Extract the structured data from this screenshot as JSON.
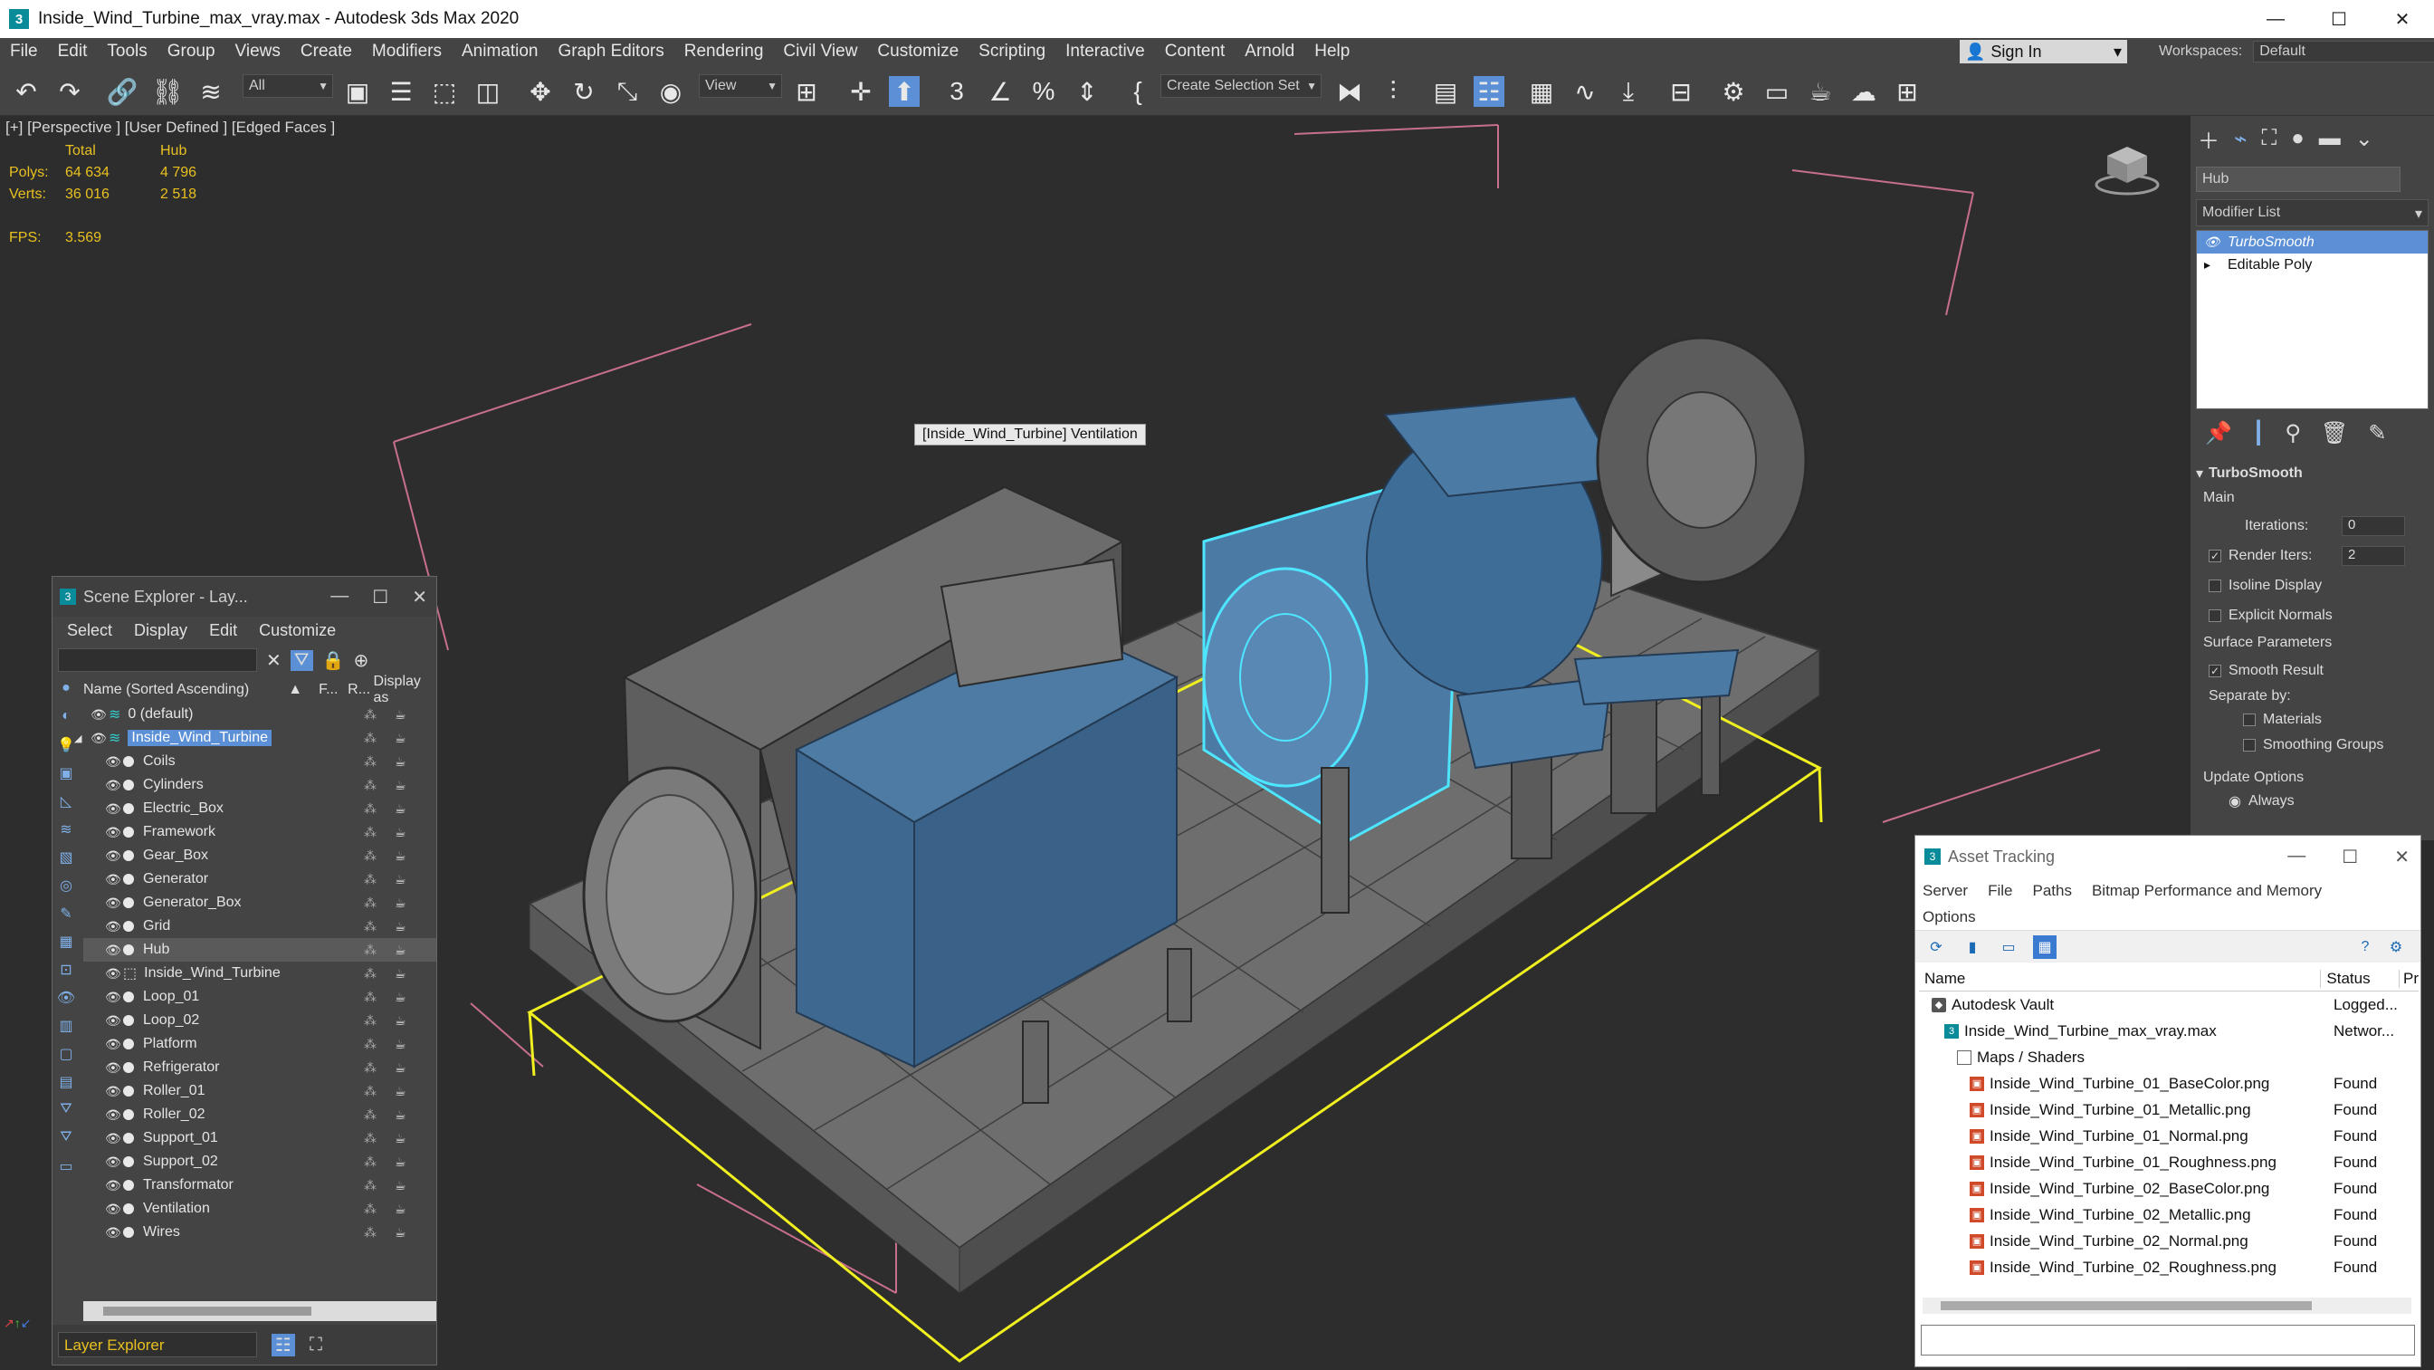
{
  "window": {
    "title": "Inside_Wind_Turbine_max_vray.max - Autodesk 3ds Max 2020",
    "app_icon_glyph": "3",
    "minimize_glyph": "—",
    "maximize_glyph": "☐",
    "close_glyph": "✕"
  },
  "menubar": {
    "items": [
      "File",
      "Edit",
      "Tools",
      "Group",
      "Views",
      "Create",
      "Modifiers",
      "Animation",
      "Graph Editors",
      "Rendering",
      "Civil View",
      "Customize",
      "Scripting",
      "Interactive",
      "Content",
      "Arnold",
      "Help"
    ],
    "signin_label": "Sign In",
    "workspaces_label": "Workspaces:",
    "workspaces_value": "Default"
  },
  "toolbar": {
    "filter_value": "All",
    "refcoord_value": "View",
    "selection_set_placeholder": "Create Selection Set"
  },
  "viewport": {
    "label": "[+] [Perspective ] [User Defined ] [Edged Faces ]",
    "stats": {
      "header_total": "Total",
      "header_selected": "Hub",
      "polys_label": "Polys:",
      "polys_total": "64 634",
      "polys_selected": "4 796",
      "verts_label": "Verts:",
      "verts_total": "36 016",
      "verts_selected": "2 518",
      "fps_label": "FPS:",
      "fps_value": "3.569"
    },
    "tooltip": "[Inside_Wind_Turbine] Ventilation"
  },
  "command_panel": {
    "object_name": "Hub",
    "modifier_list_label": "Modifier List",
    "stack": [
      {
        "label": "TurboSmooth",
        "selected": true
      },
      {
        "label": "Editable Poly",
        "selected": false
      }
    ],
    "rollout_title": "TurboSmooth",
    "main_label": "Main",
    "iterations_label": "Iterations:",
    "iterations_value": "0",
    "render_iters_label": "Render Iters:",
    "render_iters_value": "2",
    "isoline_label": "Isoline Display",
    "explicit_normals_label": "Explicit Normals",
    "surface_params_label": "Surface Parameters",
    "smooth_result_label": "Smooth Result",
    "separate_by_label": "Separate by:",
    "materials_label": "Materials",
    "smoothing_groups_label": "Smoothing Groups",
    "update_options_label": "Update Options",
    "always_label": "Always"
  },
  "scene_explorer": {
    "title": "Scene Explorer - Lay...",
    "menu": [
      "Select",
      "Display",
      "Edit",
      "Customize"
    ],
    "col_name": "Name (Sorted Ascending)",
    "col_f": "F...",
    "col_r": "R...",
    "col_display": "Display as",
    "rows": [
      {
        "label": "0 (default)",
        "level": 1,
        "kind": "layer",
        "selected": false
      },
      {
        "label": "Inside_Wind_Turbine",
        "level": 1,
        "kind": "layer",
        "selected": false,
        "highlight": true
      },
      {
        "label": "Coils",
        "level": 2,
        "kind": "object",
        "selected": false
      },
      {
        "label": "Cylinders",
        "level": 2,
        "kind": "object",
        "selected": false
      },
      {
        "label": "Electric_Box",
        "level": 2,
        "kind": "object",
        "selected": false
      },
      {
        "label": "Framework",
        "level": 2,
        "kind": "object",
        "selected": false
      },
      {
        "label": "Gear_Box",
        "level": 2,
        "kind": "object",
        "selected": false
      },
      {
        "label": "Generator",
        "level": 2,
        "kind": "object",
        "selected": false
      },
      {
        "label": "Generator_Box",
        "level": 2,
        "kind": "object",
        "selected": false
      },
      {
        "label": "Grid",
        "level": 2,
        "kind": "object",
        "selected": false
      },
      {
        "label": "Hub",
        "level": 2,
        "kind": "object",
        "selected": true
      },
      {
        "label": "Inside_Wind_Turbine",
        "level": 2,
        "kind": "group",
        "selected": false
      },
      {
        "label": "Loop_01",
        "level": 2,
        "kind": "object",
        "selected": false
      },
      {
        "label": "Loop_02",
        "level": 2,
        "kind": "object",
        "selected": false
      },
      {
        "label": "Platform",
        "level": 2,
        "kind": "object",
        "selected": false
      },
      {
        "label": "Refrigerator",
        "level": 2,
        "kind": "object",
        "selected": false
      },
      {
        "label": "Roller_01",
        "level": 2,
        "kind": "object",
        "selected": false
      },
      {
        "label": "Roller_02",
        "level": 2,
        "kind": "object",
        "selected": false
      },
      {
        "label": "Support_01",
        "level": 2,
        "kind": "object",
        "selected": false
      },
      {
        "label": "Support_02",
        "level": 2,
        "kind": "object",
        "selected": false
      },
      {
        "label": "Transformator",
        "level": 2,
        "kind": "object",
        "selected": false
      },
      {
        "label": "Ventilation",
        "level": 2,
        "kind": "object",
        "selected": false
      },
      {
        "label": "Wires",
        "level": 2,
        "kind": "object",
        "selected": false
      }
    ],
    "footer_value": "Layer Explorer"
  },
  "asset_tracking": {
    "title": "Asset Tracking",
    "menu_line1": [
      "Server",
      "File",
      "Paths",
      "Bitmap Performance and Memory"
    ],
    "menu_line2": [
      "Options"
    ],
    "col_name": "Name",
    "col_status": "Status",
    "col_extra": "Pr",
    "rows": [
      {
        "name": "Autodesk Vault",
        "status": "Logged...",
        "icon": "vault",
        "indent": 1
      },
      {
        "name": "Inside_Wind_Turbine_max_vray.max",
        "status": "Networ...",
        "icon": "max",
        "indent": 2
      },
      {
        "name": "Maps / Shaders",
        "status": "",
        "icon": "folder",
        "indent": 3
      },
      {
        "name": "Inside_Wind_Turbine_01_BaseColor.png",
        "status": "Found",
        "icon": "png",
        "indent": 4
      },
      {
        "name": "Inside_Wind_Turbine_01_Metallic.png",
        "status": "Found",
        "icon": "png",
        "indent": 4
      },
      {
        "name": "Inside_Wind_Turbine_01_Normal.png",
        "status": "Found",
        "icon": "png",
        "indent": 4
      },
      {
        "name": "Inside_Wind_Turbine_01_Roughness.png",
        "status": "Found",
        "icon": "png",
        "indent": 4
      },
      {
        "name": "Inside_Wind_Turbine_02_BaseColor.png",
        "status": "Found",
        "icon": "png",
        "indent": 4
      },
      {
        "name": "Inside_Wind_Turbine_02_Metallic.png",
        "status": "Found",
        "icon": "png",
        "indent": 4
      },
      {
        "name": "Inside_Wind_Turbine_02_Normal.png",
        "status": "Found",
        "icon": "png",
        "indent": 4
      },
      {
        "name": "Inside_Wind_Turbine_02_Roughness.png",
        "status": "Found",
        "icon": "png",
        "indent": 4
      }
    ]
  },
  "colors": {
    "selection_yellow": "#f0f020",
    "highlight_cyan": "#4ee6ff",
    "model_blue": "#3f6e99",
    "stats_yellow": "#e8c020"
  }
}
